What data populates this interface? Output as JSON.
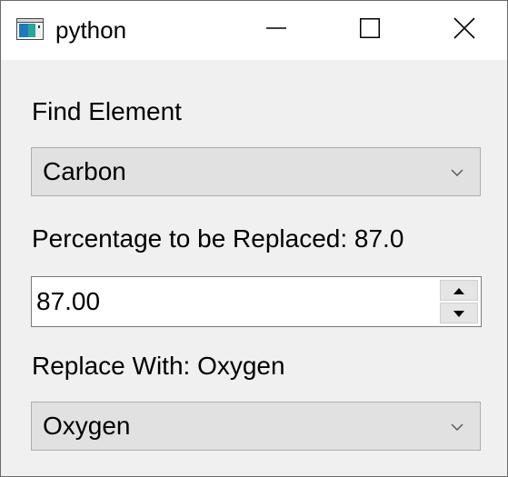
{
  "window": {
    "title": "python",
    "buttons": {
      "minimize": "minimize-icon",
      "maximize": "maximize-icon",
      "close": "close-icon"
    }
  },
  "form": {
    "find_label": "Find Element",
    "find_selected": "Carbon",
    "percentage_label": "Percentage to be Replaced: 87.0",
    "percentage_value": "87.00",
    "replace_label": "Replace With: Oxygen",
    "replace_selected": "Oxygen"
  },
  "colors": {
    "window_bg": "#f0f0f0",
    "titlebar_bg": "#ffffff",
    "combo_bg": "#e1e1e1",
    "combo_border": "#adadad",
    "app_icon_blue": "#1e7ab8",
    "app_icon_teal": "#2aa59a"
  }
}
